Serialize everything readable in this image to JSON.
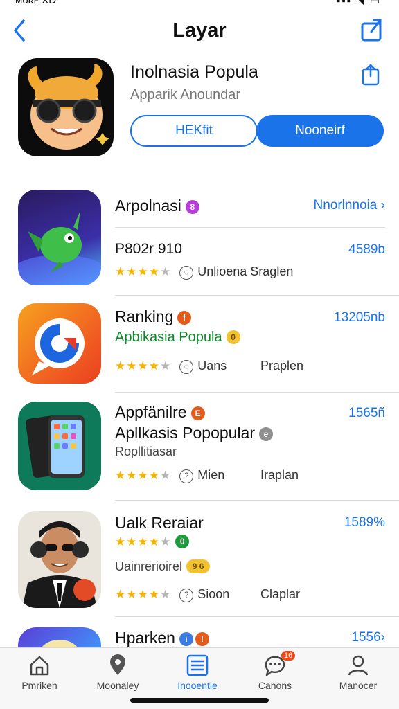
{
  "status": {
    "carrier": "ᴍᴏʀᴇ XD",
    "right": "▪▪▪ ◥ ▭"
  },
  "nav": {
    "title": "Layar"
  },
  "hero": {
    "name": "Inolnasia Popula",
    "subtitle": "Apparik Anoundar",
    "btn_outline": "HEKfit",
    "btn_fill": "Nooneirf"
  },
  "rows": [
    {
      "title": "Arpolnasi",
      "badge": "8",
      "badge_color": "#b53dd8",
      "link": "Nnorlnnoia",
      "line2": "P802r 910",
      "price": "4589b",
      "stars": "★★★★",
      "stars_off": "★",
      "meta1": "Unlioena",
      "meta2": "Sraglen"
    },
    {
      "title": "Ranking",
      "badge": "†",
      "badge_color": "#e35a1b",
      "price": "13205nb",
      "green": "Apbikasia Popula",
      "stars": "★★★★",
      "stars_off": "★",
      "meta1": "Uans",
      "meta2": "Praplen"
    },
    {
      "title": "Appfänilre",
      "badge": "E",
      "badge_color": "#e35a1b",
      "price": "1565ñ",
      "line2": "Apllkasis Popopular",
      "badge2": "e",
      "sub": "Ropllitiasar",
      "stars": "★★★★",
      "stars_off": "★",
      "meta1": "Mien",
      "meta2": "Iraplan"
    },
    {
      "title": "Ualk Reraiar",
      "price": "1589%",
      "stars": "★★★★",
      "stars_off": "★",
      "badge": "0",
      "badge_color": "#1f9d3c",
      "sub": "Uainrerioirel",
      "badge3": "9 6",
      "stars2": "★★★★",
      "meta1": "Sioon",
      "meta2": "Claplar"
    },
    {
      "title": "Hparken",
      "price": "1556›"
    }
  ],
  "tabs": [
    {
      "label": "Pmrikeh",
      "icon": "home-icon"
    },
    {
      "label": "Moonaley",
      "icon": "pin-icon"
    },
    {
      "label": "Inooentie",
      "icon": "list-icon"
    },
    {
      "label": "Canons",
      "icon": "chat-icon",
      "badge": "16"
    },
    {
      "label": "Manocer",
      "icon": "person-icon"
    }
  ]
}
